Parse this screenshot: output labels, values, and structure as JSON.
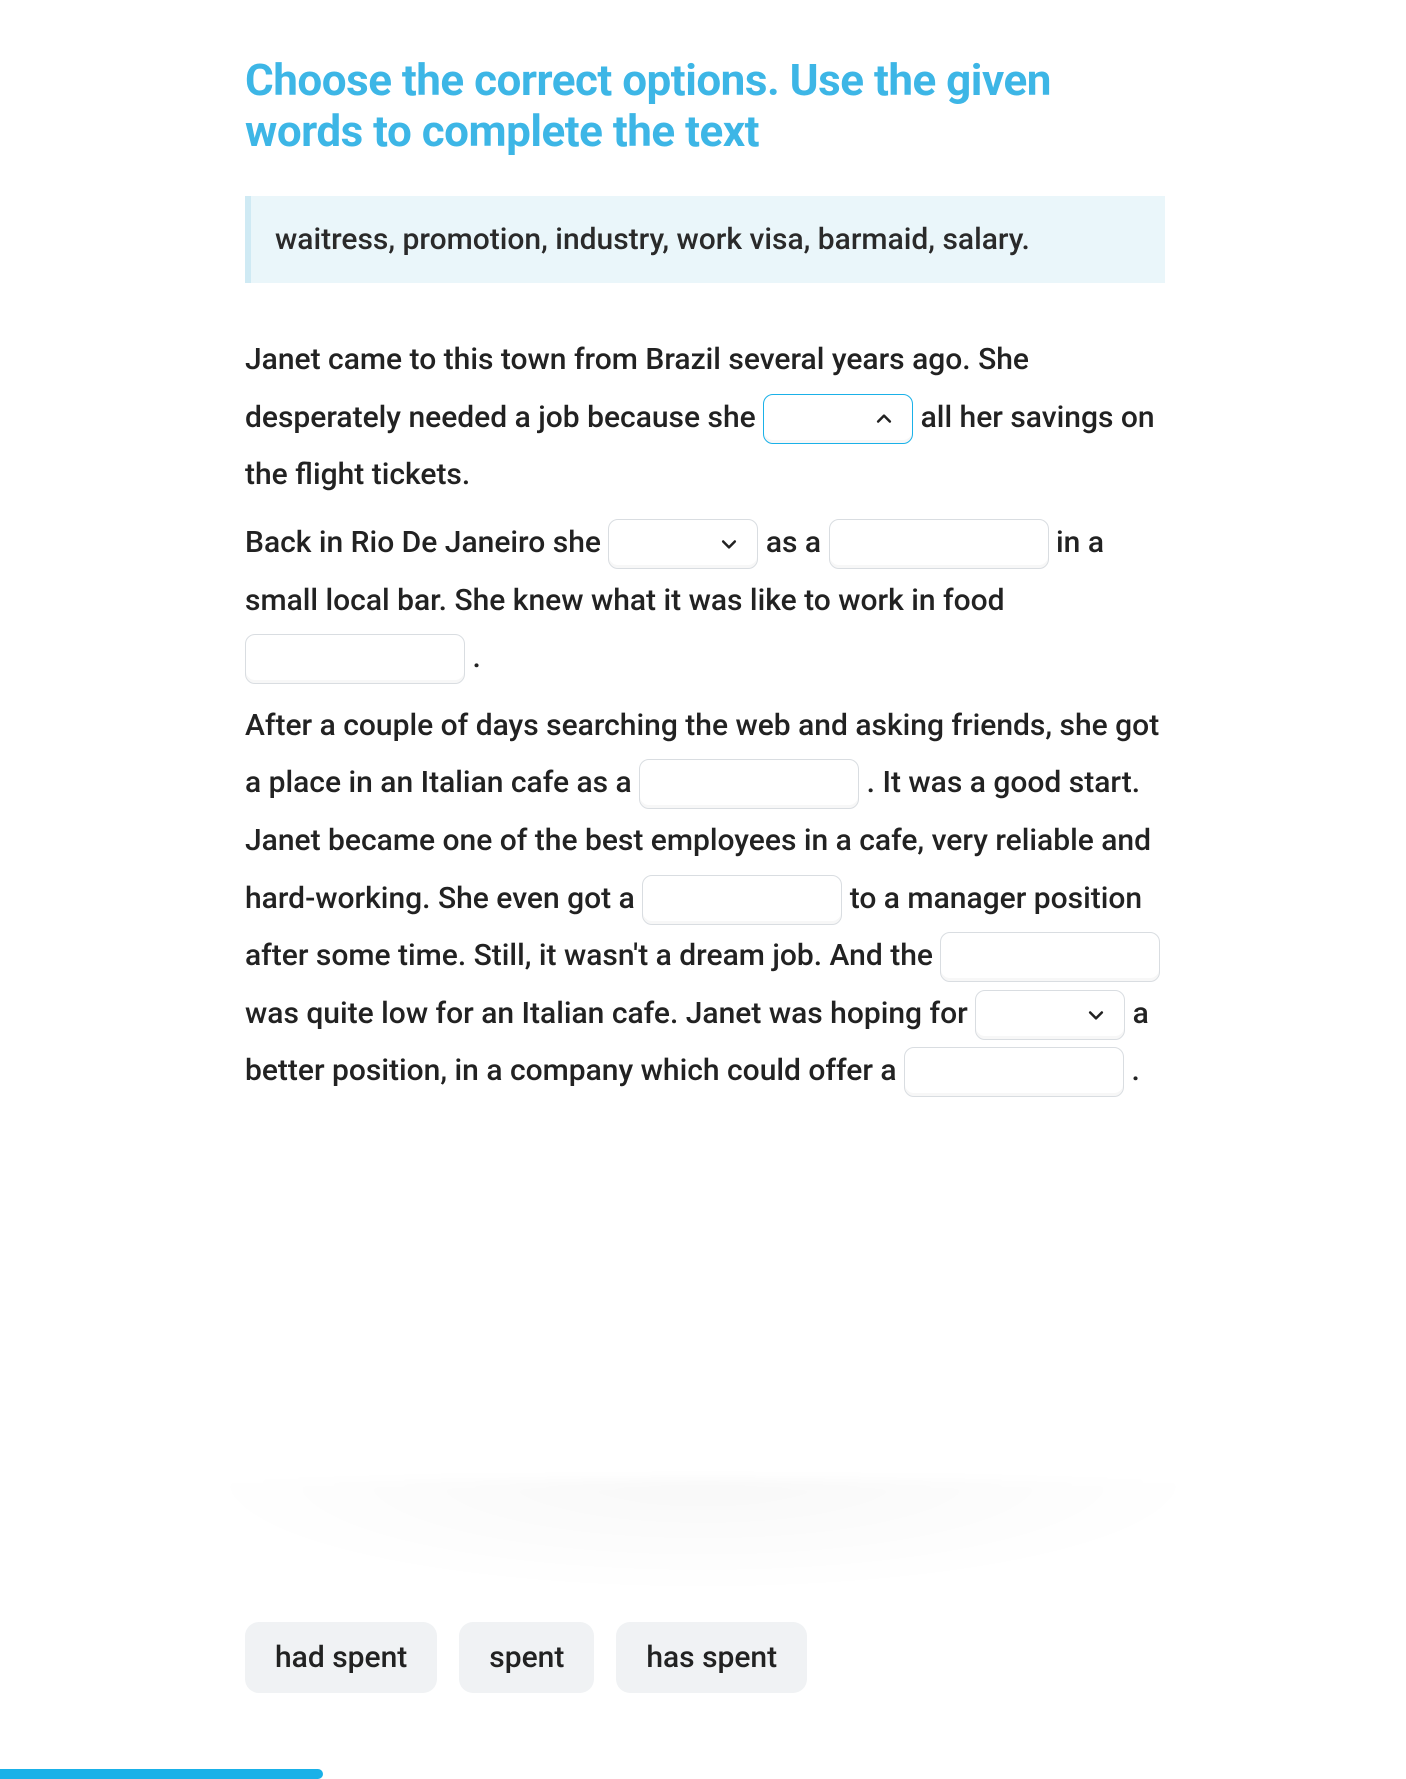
{
  "title": "Choose the correct options. Use the given words to complete the text",
  "word_bank": "waitress, promotion, industry, work visa, barmaid, salary.",
  "passage": {
    "p1_a": "Janet came to this town from Brazil several years ago. She desperately needed a job because she ",
    "p1_b": " all her savings on the flight tickets.",
    "p2_a": "Back in Rio De Janeiro she ",
    "p2_b": " as a ",
    "p2_c": " in a small local bar. She knew what it was like to work in food ",
    "p2_d": " .",
    "p3_a": "After a couple of days searching the web and asking friends, she got a place in an Italian cafe as a ",
    "p3_b": ". It was a good start. Janet became one of the best employees in a cafe, very reliable and hard-working. She even got a ",
    "p3_c": " to a manager position after some time. Still, it wasn't a dream job. And the ",
    "p3_d": " was quite low for an Italian cafe. Janet was hoping for ",
    "p3_e": " a better position, in a company which could offer a ",
    "p3_f": "."
  },
  "gaps": {
    "gap1": {
      "type": "select",
      "state": "open",
      "value": ""
    },
    "gap2": {
      "type": "select",
      "state": "closed",
      "value": ""
    },
    "gap3": {
      "type": "fill",
      "value": ""
    },
    "gap4": {
      "type": "fill",
      "value": ""
    },
    "gap5": {
      "type": "fill",
      "value": ""
    },
    "gap6": {
      "type": "fill",
      "value": ""
    },
    "gap7": {
      "type": "fill",
      "value": ""
    },
    "gap8": {
      "type": "select",
      "state": "closed",
      "value": ""
    },
    "gap9": {
      "type": "fill",
      "value": ""
    }
  },
  "options": [
    "had spent",
    "spent",
    "has spent"
  ],
  "progress_percent": 23
}
